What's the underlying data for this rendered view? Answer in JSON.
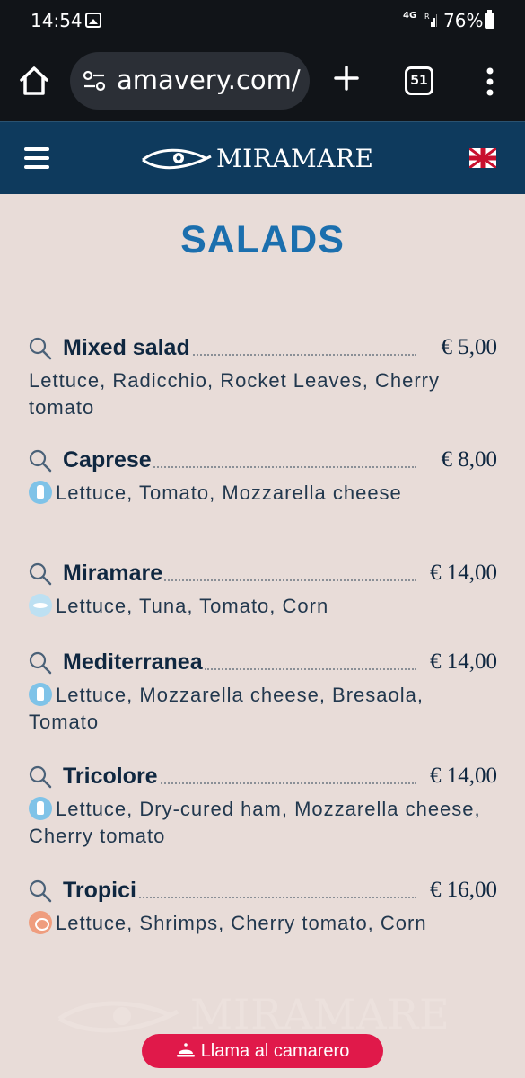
{
  "status_bar": {
    "time": "14:54",
    "network": "4G",
    "signal_label": "R",
    "battery": "76%"
  },
  "browser": {
    "url": "amavery.com/",
    "tab_count": "51"
  },
  "site_header": {
    "brand": "MIRAMARE"
  },
  "section": {
    "title": "SALADS"
  },
  "items": [
    {
      "name": "Mixed salad",
      "price": "€ 5,00",
      "allergen": null,
      "description": "Lettuce, Radicchio, Rocket Leaves, Cherry tomato"
    },
    {
      "name": "Caprese",
      "price": "€ 8,00",
      "allergen": "milk-icon",
      "description": "Lettuce, Tomato, Mozzarella cheese"
    },
    {
      "name": "Miramare",
      "price": "€ 14,00",
      "allergen": "fish-icon",
      "description": "Lettuce, Tuna, Tomato, Corn"
    },
    {
      "name": "Mediterranea",
      "price": "€ 14,00",
      "allergen": "milk-icon",
      "description": "Lettuce, Mozzarella cheese, Bresaola, Tomato"
    },
    {
      "name": "Tricolore",
      "price": "€ 14,00",
      "allergen": "milk-icon",
      "description": "Lettuce, Dry-cured ham, Mozzarella cheese, Cherry tomato"
    },
    {
      "name": "Tropici",
      "price": "€ 16,00",
      "allergen": "crustacean-icon",
      "description": "Lettuce, Shrimps, Cherry tomato, Corn"
    }
  ],
  "footer": {
    "watermark": "MIRAMARE",
    "call_waiter_label": "Llama al camarero"
  },
  "colors": {
    "header_bg": "#0e3a5d",
    "title_blue": "#1b6fae",
    "page_bg": "#e8dcd8",
    "cta_red": "#e0194a"
  }
}
